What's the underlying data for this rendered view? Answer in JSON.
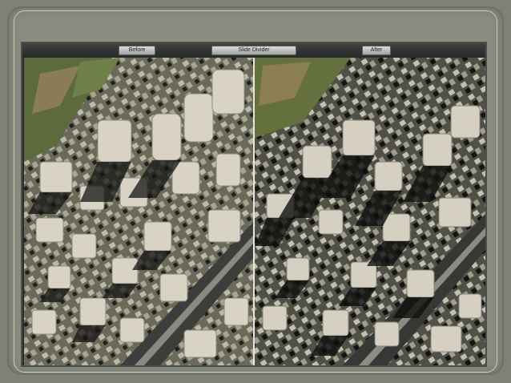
{
  "toolbar": {
    "before_label": "Before",
    "mode_label": "Slide Divider",
    "after_label": "After"
  },
  "panes": {
    "before": {
      "watermark": ""
    },
    "after": {
      "watermark": ""
    }
  },
  "colors": {
    "slide_background": "#7d8274",
    "viewer_background": "#2b2d2c",
    "divider": "#e6e6e0"
  }
}
